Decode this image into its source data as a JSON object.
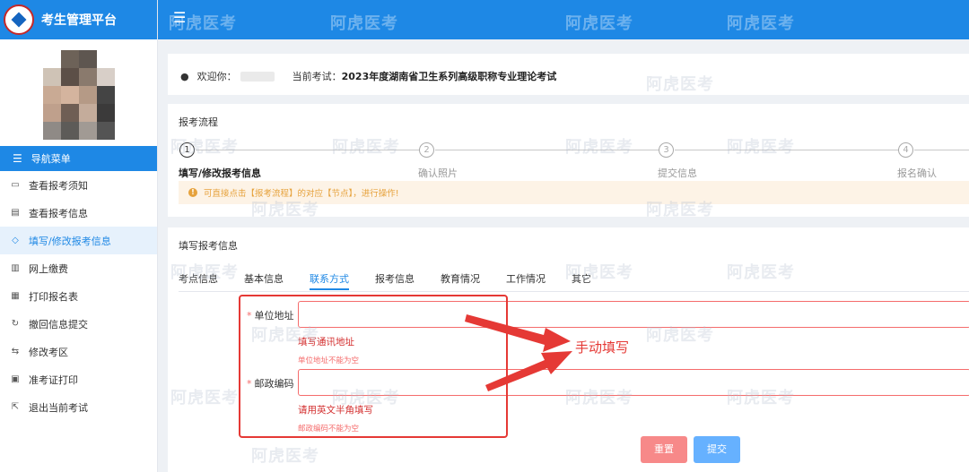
{
  "app": {
    "title": "考生管理平台"
  },
  "nav": {
    "header": "导航菜单",
    "items": [
      {
        "label": "查看报考须知",
        "icon": "notice-icon"
      },
      {
        "label": "查看报考信息",
        "icon": "document-icon"
      },
      {
        "label": "填写/修改报考信息",
        "icon": "shield-check-icon",
        "active": true
      },
      {
        "label": "网上缴费",
        "icon": "payment-icon"
      },
      {
        "label": "打印报名表",
        "icon": "print-icon"
      },
      {
        "label": "撤回信息提交",
        "icon": "undo-icon"
      },
      {
        "label": "修改考区",
        "icon": "swap-icon"
      },
      {
        "label": "准考证打印",
        "icon": "card-icon"
      },
      {
        "label": "退出当前考试",
        "icon": "exit-icon"
      }
    ]
  },
  "welcome": {
    "greeting": "欢迎你：",
    "current_exam_label": "当前考试：",
    "current_exam": "2023年度湖南省卫生系列高级职称专业理论考试"
  },
  "flow": {
    "title": "报考流程",
    "steps": [
      {
        "num": "1",
        "label": "填写/修改报考信息"
      },
      {
        "num": "2",
        "label": "确认照片"
      },
      {
        "num": "3",
        "label": "提交信息"
      },
      {
        "num": "4",
        "label": "报名确认"
      }
    ],
    "notice": "可直接点击【报考流程】的对应【节点】，进行操作!"
  },
  "form": {
    "title": "填写报考信息",
    "tabs": [
      "考点信息",
      "基本信息",
      "联系方式",
      "报考信息",
      "教育情况",
      "工作情况",
      "其它"
    ],
    "active_tab": 2,
    "fields": [
      {
        "label": "单位地址",
        "value": "",
        "hint": "填写通讯地址",
        "error": "单位地址不能为空"
      },
      {
        "label": "邮政编码",
        "value": "",
        "hint": "请用英文半角填写",
        "error": "邮政编码不能为空"
      }
    ]
  },
  "annotation": {
    "text": "手动填写"
  },
  "buttons": {
    "reset": "重置",
    "submit": "提交"
  },
  "watermark": "阿虎医考",
  "colors": {
    "primary": "#1e88e5",
    "danger": "#f56c6c",
    "warning": "#e6a23c"
  }
}
